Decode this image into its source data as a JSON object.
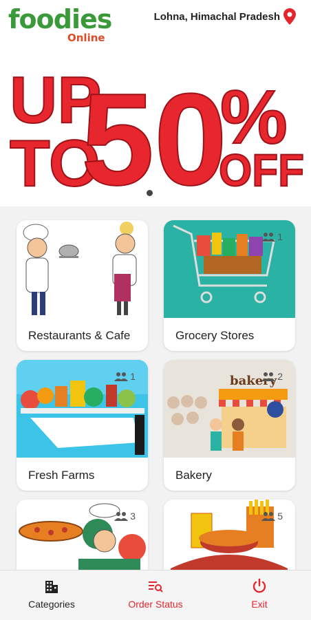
{
  "header": {
    "logo_main": "foodies",
    "logo_sub": "Online",
    "location": "Lohna, Himachal Pradesh"
  },
  "banner": {
    "line1": "UP",
    "line2": "TO",
    "big": "50",
    "pct": "%",
    "off": "OFF",
    "color": "#e8262e"
  },
  "categories": [
    {
      "label": "Restaurants & Cafe",
      "count": ""
    },
    {
      "label": "Grocery Stores",
      "count": "1"
    },
    {
      "label": "Fresh Farms",
      "count": "1"
    },
    {
      "label": "Bakery",
      "count": "2"
    },
    {
      "label": "",
      "count": "3"
    },
    {
      "label": "",
      "count": "5"
    }
  ],
  "bottom_nav": {
    "categories": "Categories",
    "order_status": "Order Status",
    "exit": "Exit",
    "accent": "#e3262e"
  }
}
